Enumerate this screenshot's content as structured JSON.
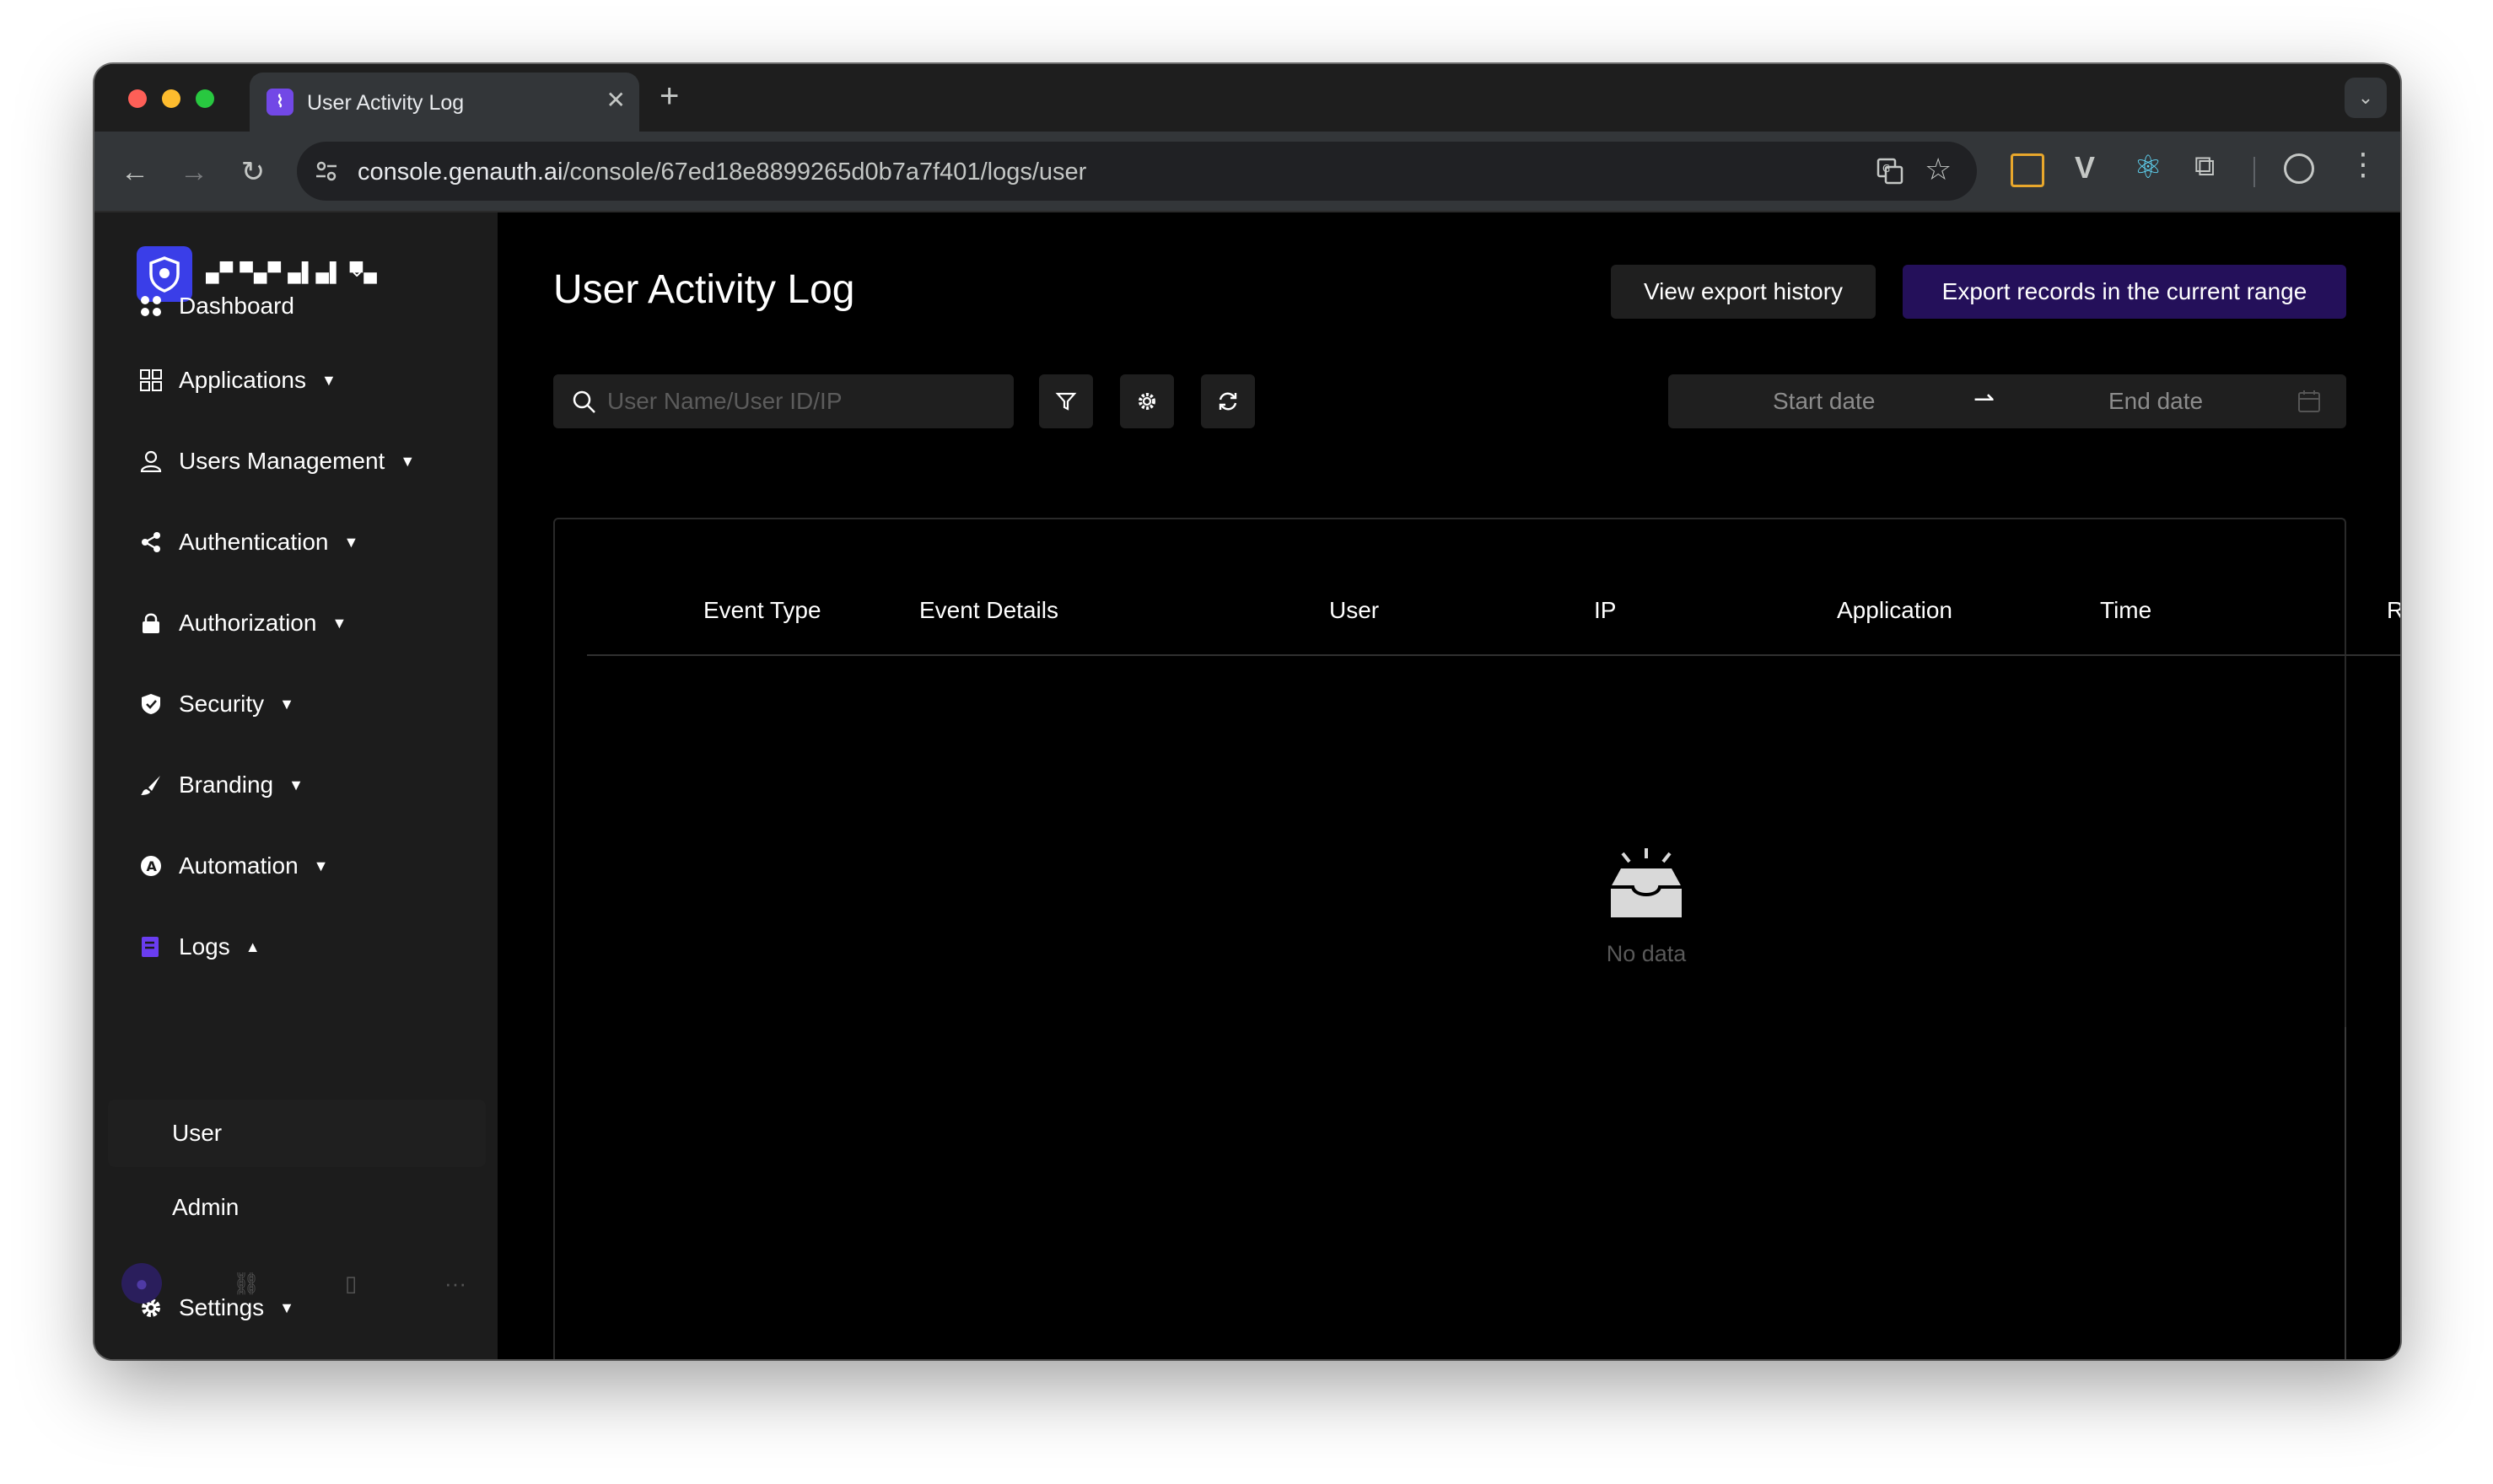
{
  "browser": {
    "tab_title": "User Activity Log",
    "tab_close": "✕",
    "new_tab": "+",
    "tab_dropdown": "⌄",
    "url_domain": "console.genauth.ai",
    "url_path": "/console/67ed18e8899265d0b7a7f401/logs/user",
    "colors": {
      "close": "#fe5f57",
      "minimize": "#febc2e",
      "maximize": "#28c840"
    }
  },
  "sidebar": {
    "org_name": "▄▀ ▀▄▀ ▄▌▄▌ ▀▄",
    "items": [
      {
        "label": "Dashboard",
        "icon": "dashboard-icon",
        "caret": ""
      },
      {
        "label": "Applications",
        "icon": "applications-icon",
        "caret": "▼"
      },
      {
        "label": "Users Management",
        "icon": "user-icon",
        "caret": "▼"
      },
      {
        "label": "Authentication",
        "icon": "share-icon",
        "caret": "▼"
      },
      {
        "label": "Authorization",
        "icon": "lock-icon",
        "caret": "▼"
      },
      {
        "label": "Security",
        "icon": "shield-icon",
        "caret": "▼"
      },
      {
        "label": "Branding",
        "icon": "brush-icon",
        "caret": "▼"
      },
      {
        "label": "Automation",
        "icon": "automation-icon",
        "caret": "▼"
      },
      {
        "label": "Logs",
        "icon": "logs-icon",
        "caret": "▲"
      },
      {
        "label": "Settings",
        "icon": "gear-icon",
        "caret": "▼"
      }
    ],
    "logs_sub": [
      "User",
      "Admin"
    ],
    "footer": {
      "more": "···"
    }
  },
  "main": {
    "title": "User Activity Log",
    "view_export_history": "View export history",
    "export_records": "Export records in the current range",
    "search": {
      "placeholder": "User Name/User ID/IP"
    },
    "date": {
      "start": "Start date",
      "end": "End date",
      "separator": "⇀"
    },
    "table": {
      "headers": [
        "Event Type",
        "Event Details",
        "User",
        "IP",
        "Application",
        "Time",
        "R"
      ],
      "empty_text": "No data"
    },
    "colors": {
      "accent": "#24105a",
      "button": "#1f1f1f"
    }
  }
}
